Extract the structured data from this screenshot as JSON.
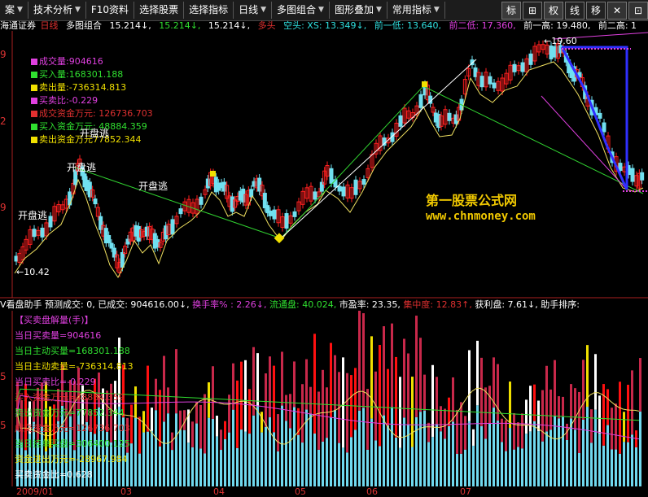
{
  "toolbar": {
    "items": [
      {
        "label": "案",
        "arrow": "▼"
      },
      {
        "label": "技术分析",
        "arrow": "▼"
      },
      {
        "label": "F10资料",
        "arrow": ""
      },
      {
        "label": "选择股票",
        "arrow": ""
      },
      {
        "label": "选择指标",
        "arrow": ""
      },
      {
        "label": "日线",
        "arrow": "▼"
      },
      {
        "label": "多图组合",
        "arrow": "▼"
      },
      {
        "label": "图形叠加",
        "arrow": "▼"
      },
      {
        "label": "常用指标",
        "arrow": "▼"
      }
    ],
    "right": [
      "标",
      "⊞",
      "权",
      "线",
      "移",
      "✕",
      "⊡"
    ]
  },
  "header": {
    "stock": "海通证券",
    "period": "日线",
    "combo": "多图组合",
    "v1": "15.214↓,",
    "v2": "15.214↓,",
    "v3": "15.214↓,",
    "trend": "多头",
    "kong": "空头: XS: 13.349↓,",
    "qianyidi": "前一低: 13.640,",
    "qianerdi": "前二低: 17.360,",
    "qianyigao": "前一高: 19.480,",
    "qianergao": "前二高: 1"
  },
  "legend": [
    {
      "text": "成交量:904616",
      "color": "#e040e0"
    },
    {
      "text": "买入量:168301.188",
      "color": "#30e030"
    },
    {
      "text": "卖出量:-736314.813",
      "color": "#f0e000"
    },
    {
      "text": "买卖比:-0.229",
      "color": "#e040e0"
    },
    {
      "text": "成交资金万元: 126736.703",
      "color": "#e03030"
    },
    {
      "text": "买入资金万元: 48884.359",
      "color": "#30e030"
    },
    {
      "text": "卖出资金万元77852.344",
      "color": "#f0e000"
    }
  ],
  "annotations": {
    "kaipantao1": "开盘逃",
    "kaipantao2": "开盘逃",
    "kaipantao3": "开盘逃",
    "kaipantao4": "开盘逃",
    "low_label": "←10.42",
    "high_label": "←19.60"
  },
  "watermark": {
    "line1": "第一股票公式网",
    "line2": "www.chnmoney.com"
  },
  "ind_header": {
    "name": "V看盘助手",
    "yuce": "预测成交: 0,",
    "yicj": "已成交: 904616.00↓,",
    "hsl": "换手率% : 2.26↓,",
    "ltp": "流通盘: 40.024,",
    "syl": "市盈率: 23.35,",
    "jzd": "集中度: 12.83↑,",
    "hlp": "获利盘: 7.61↓,",
    "zspx": "助手排序:"
  },
  "ind_list": [
    {
      "text": "【买卖盘解量(手)】",
      "color": "#e040e0"
    },
    {
      "text": "当日买卖量=904616",
      "color": "#e040e0"
    },
    {
      "text": "当日主动买量=168301.188",
      "color": "#30e030"
    },
    {
      "text": "当日主动卖量=-736314.813",
      "color": "#f0e000"
    },
    {
      "text": "当日买卖比=-0.229",
      "color": "#e040e0"
    },
    {
      "text": "买入资金万元=48884.359",
      "color": "#e03030"
    },
    {
      "text": "卖出资金万元=77852.344",
      "color": "#30e030"
    },
    {
      "text": "成交资金万元=126736.703",
      "color": "#e03030"
    },
    {
      "text": "当日挂单买盘=306400.125",
      "color": "#30e030"
    },
    {
      "text": "资金进出万元=-28967.984",
      "color": "#f0e000"
    },
    {
      "text": "买卖资金比=0.628",
      "color": "#ffffff"
    }
  ],
  "yaxis": {
    "main": [
      "9",
      "2",
      "9"
    ],
    "ind": [
      "5",
      "5"
    ]
  },
  "xaxis": [
    "2009/01",
    "03",
    "04",
    "05",
    "06",
    "07"
  ],
  "colors": {
    "up": "#ff2020",
    "down": "#70e0f0",
    "ma": "#f0e060",
    "accent": "#f0c800",
    "trend": "#3030ff"
  }
}
